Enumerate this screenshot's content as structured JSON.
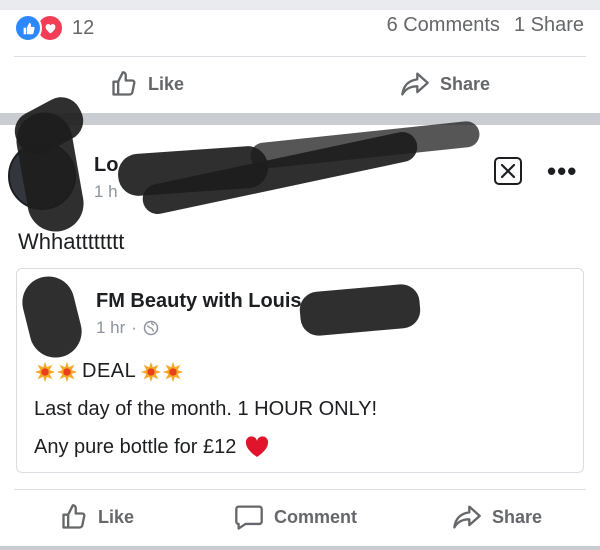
{
  "reactions": {
    "count": "12",
    "types": [
      "like-icon",
      "love-icon"
    ]
  },
  "stats": {
    "comments": "6 Comments",
    "shares": "1 Share"
  },
  "top_actions": {
    "like": "Like",
    "share": "Share"
  },
  "post": {
    "author_visible": "Lo",
    "time_visible": "1 h",
    "text": "Whhatttttttt"
  },
  "shared_post": {
    "author": "FM Beauty with Louis",
    "time": "1 hr",
    "dot": "·",
    "deal": "DEAL",
    "line2": "Last day of the month. 1 HOUR ONLY!",
    "line3": "Any pure bottle for £12"
  },
  "bottom_actions": {
    "like": "Like",
    "comment": "Comment",
    "share": "Share"
  },
  "colors": {
    "like_blue": "#2d88ff",
    "love_red": "#f33e58",
    "meta_gray": "#65676b"
  }
}
